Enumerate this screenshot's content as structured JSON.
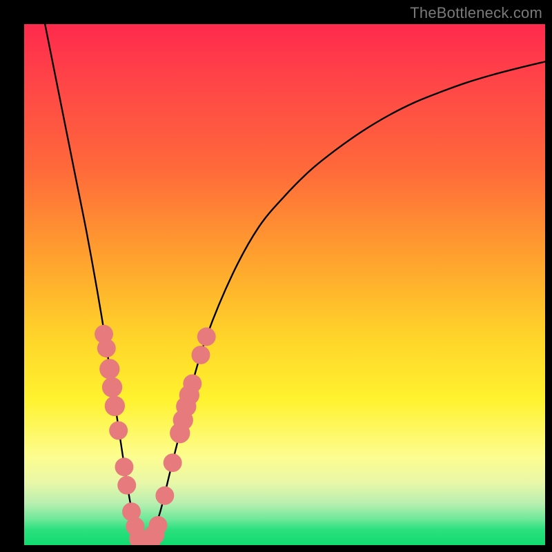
{
  "watermark": "TheBottleneck.com",
  "colors": {
    "background_outer": "#000000",
    "curve": "#000000",
    "dot": "#e77a7d",
    "watermark": "#7a7a7a",
    "gradient_top": "#ff2a4d",
    "gradient_bottom": "#10db6e"
  },
  "chart_data": {
    "type": "line",
    "title": "",
    "xlabel": "",
    "ylabel": "",
    "xlim": [
      0,
      100
    ],
    "ylim": [
      0,
      100
    ],
    "grid": false,
    "series": [
      {
        "name": "bottleneck-curve",
        "x": [
          4,
          6,
          8,
          10,
          12,
          14,
          15.5,
          17,
          18.5,
          20.4,
          22,
          23.3,
          24,
          26,
          28,
          30,
          32,
          35,
          40,
          45,
          50,
          55,
          60,
          65,
          70,
          75,
          80,
          85,
          90,
          95,
          100
        ],
        "y": [
          100,
          90,
          80,
          70,
          60,
          49,
          40,
          30,
          20,
          8,
          2,
          0,
          1,
          6,
          14,
          22,
          30,
          40,
          52,
          61,
          67,
          72,
          76,
          79.5,
          82.5,
          85,
          87,
          88.8,
          90.3,
          91.6,
          92.8
        ]
      }
    ],
    "scatter_overlay": {
      "name": "sample-points",
      "points": [
        {
          "x": 15.3,
          "y": 40.5,
          "r": 1.4
        },
        {
          "x": 15.8,
          "y": 37.8,
          "r": 1.4
        },
        {
          "x": 16.4,
          "y": 33.8,
          "r": 1.6
        },
        {
          "x": 16.9,
          "y": 30.3,
          "r": 1.6
        },
        {
          "x": 17.4,
          "y": 26.7,
          "r": 1.6
        },
        {
          "x": 18.1,
          "y": 22.0,
          "r": 1.4
        },
        {
          "x": 19.2,
          "y": 15.0,
          "r": 1.4
        },
        {
          "x": 19.7,
          "y": 11.5,
          "r": 1.4
        },
        {
          "x": 20.6,
          "y": 6.4,
          "r": 1.4
        },
        {
          "x": 21.3,
          "y": 3.6,
          "r": 1.4
        },
        {
          "x": 22.1,
          "y": 1.2,
          "r": 1.6
        },
        {
          "x": 22.8,
          "y": 0.4,
          "r": 1.6
        },
        {
          "x": 23.5,
          "y": 0.2,
          "r": 1.6
        },
        {
          "x": 24.2,
          "y": 0.7,
          "r": 1.6
        },
        {
          "x": 25.0,
          "y": 2.0,
          "r": 1.6
        },
        {
          "x": 25.7,
          "y": 3.8,
          "r": 1.4
        },
        {
          "x": 27.0,
          "y": 9.5,
          "r": 1.4
        },
        {
          "x": 28.5,
          "y": 15.8,
          "r": 1.4
        },
        {
          "x": 29.9,
          "y": 21.5,
          "r": 1.6
        },
        {
          "x": 30.5,
          "y": 24.0,
          "r": 1.6
        },
        {
          "x": 31.1,
          "y": 26.6,
          "r": 1.6
        },
        {
          "x": 31.7,
          "y": 28.8,
          "r": 1.6
        },
        {
          "x": 32.3,
          "y": 31.0,
          "r": 1.4
        },
        {
          "x": 33.9,
          "y": 36.5,
          "r": 1.4
        },
        {
          "x": 35.0,
          "y": 40.0,
          "r": 1.4
        }
      ]
    },
    "curve_min": {
      "x": 23.3,
      "y": 0
    }
  }
}
